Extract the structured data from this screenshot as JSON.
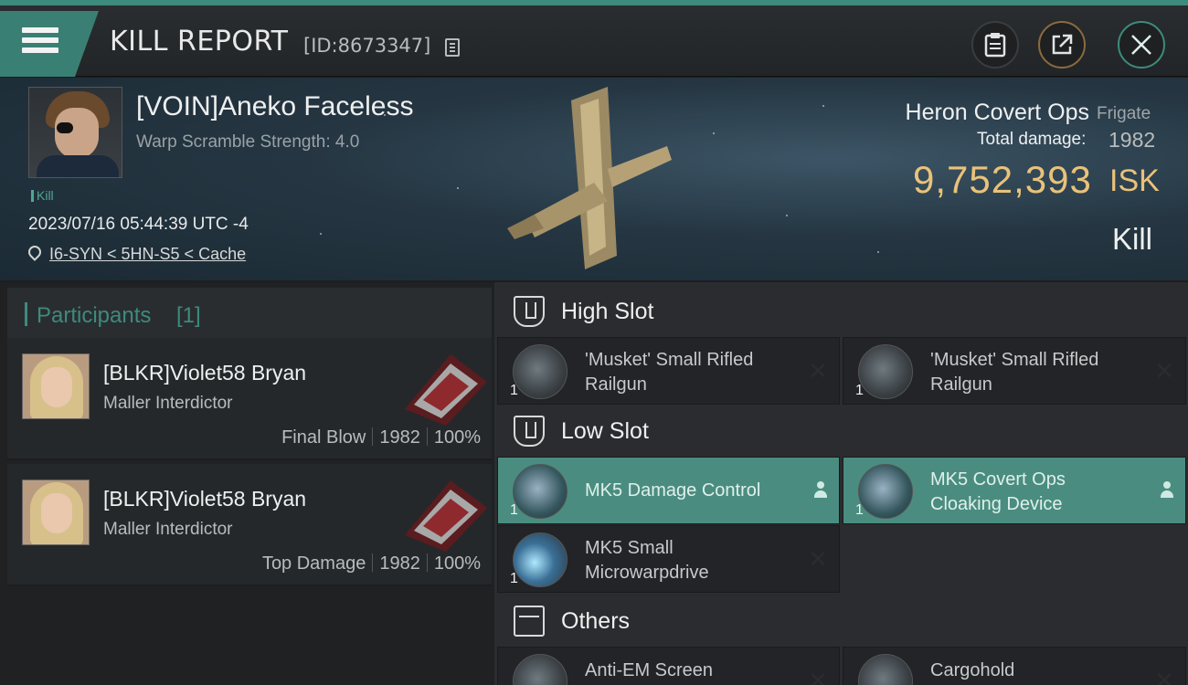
{
  "header": {
    "title": "KILL REPORT",
    "report_id": "[ID:8673347]",
    "icons": {
      "menu": "hamburger-menu-icon",
      "copy": "copy-icon",
      "clipboard": "clipboard-icon",
      "share": "share-icon",
      "close": "close-icon"
    },
    "accent_color": "#3d8b7d"
  },
  "victim": {
    "name": "[VOIN]Aneko Faceless",
    "warp_scramble": "Warp Scramble Strength: 4.0",
    "tag": "Kill",
    "datetime": "2023/07/16 05:44:39 UTC -4",
    "location": "I6-SYN < 5HN-S5 < Cache",
    "ship_name": "Heron Covert Ops",
    "ship_class": "Frigate",
    "total_damage_label": "Total damage:",
    "total_damage": "1982",
    "isk_value": "9,752,393",
    "isk_unit": "ISK",
    "result": "Kill",
    "isk_color": "#e9c27a"
  },
  "participants": {
    "label": "Participants",
    "count": "[1]",
    "list": [
      {
        "name": "[BLKR]Violet58 Bryan",
        "ship": "Maller Interdictor",
        "role": "Final Blow",
        "damage": "1982",
        "percent": "100%"
      },
      {
        "name": "[BLKR]Violet58 Bryan",
        "ship": "Maller Interdictor",
        "role": "Top Damage",
        "damage": "1982",
        "percent": "100%"
      }
    ]
  },
  "fittings": {
    "high_slot": {
      "label": "High Slot",
      "modules": [
        {
          "name_line1": "'Musket' Small Rifled",
          "name_line2": "Railgun",
          "qty": "1",
          "status": "destroyed"
        },
        {
          "name_line1": "'Musket' Small Rifled",
          "name_line2": "Railgun",
          "qty": "1",
          "status": "destroyed"
        }
      ]
    },
    "low_slot": {
      "label": "Low Slot",
      "modules": [
        {
          "name_line1": "MK5 Damage Control",
          "name_line2": "",
          "qty": "1",
          "status": "dropped"
        },
        {
          "name_line1": "MK5 Covert Ops",
          "name_line2": "Cloaking Device",
          "qty": "1",
          "status": "dropped"
        },
        {
          "name_line1": "MK5 Small",
          "name_line2": "Microwarpdrive",
          "qty": "1",
          "status": "destroyed"
        }
      ]
    },
    "others": {
      "label": "Others",
      "modules": [
        {
          "name_line1": "Anti-EM Screen",
          "qty": "",
          "status": "destroyed"
        },
        {
          "name_line1": "Cargohold",
          "qty": "",
          "status": "destroyed"
        }
      ]
    }
  }
}
